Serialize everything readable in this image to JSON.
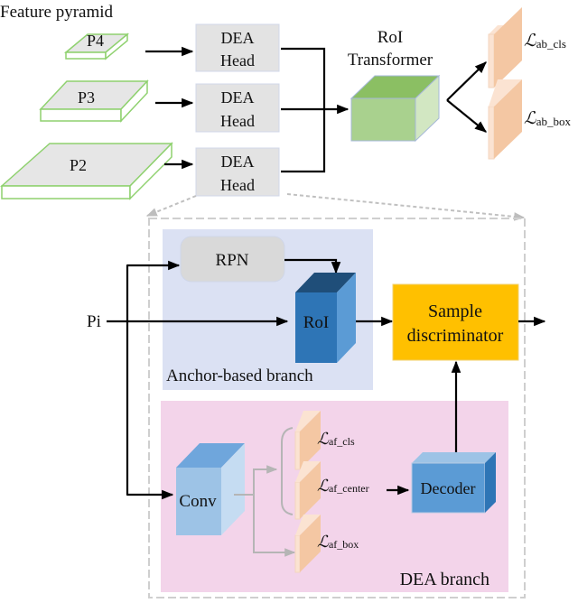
{
  "top": {
    "pyramid_title": "Feature pyramid",
    "levels": [
      "P4",
      "P3",
      "P2"
    ],
    "head_line1": "DEA",
    "head_line2": "Head",
    "roi_transformer_line1": "RoI",
    "roi_transformer_line2": "Transformer",
    "loss_cls": {
      "symbol": "ℒ",
      "sub": "ab_cls"
    },
    "loss_box": {
      "symbol": "ℒ",
      "sub": "ab_box"
    }
  },
  "detail": {
    "input_label": "Pi",
    "rpn_label": "RPN",
    "roi_label": "RoI",
    "anchor_branch_label": "Anchor-based branch",
    "sample_line1": "Sample",
    "sample_line2": "discriminator",
    "conv_label": "Conv",
    "loss_af_cls": {
      "symbol": "ℒ",
      "sub": "af_cls"
    },
    "loss_af_center": {
      "symbol": "ℒ",
      "sub": "af_center"
    },
    "loss_af_box": {
      "symbol": "ℒ",
      "sub": "af_box"
    },
    "decoder_label": "Decoder",
    "dea_branch_label": "DEA branch"
  },
  "colors": {
    "anchor_bg": "#dbe1f3",
    "dea_bg": "#f3d4ea",
    "sample_fill": "#ffc000",
    "roi_cube": "#2e75b6",
    "transformer_cube": "#a9d18e",
    "loss_plate": "#f4c7a3",
    "head_fill": "#e3e3e3"
  }
}
